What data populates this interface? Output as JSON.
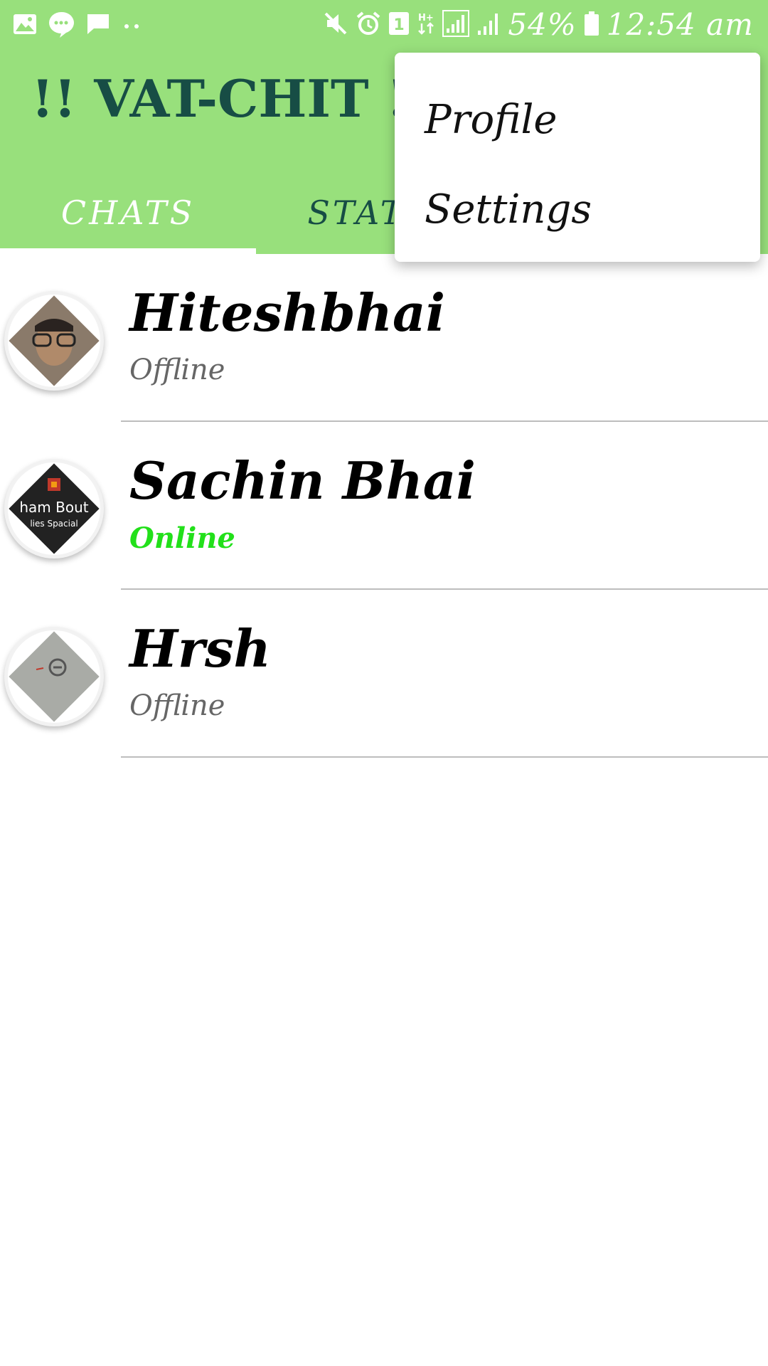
{
  "status_bar": {
    "battery": "54%",
    "time": "12:54 am",
    "icons_left": [
      "image-icon",
      "chat-bubble-icon",
      "message-icon",
      "more-dots-icon"
    ],
    "icons_right": [
      "mute-icon",
      "alarm-icon",
      "sim-icon",
      "data-icon",
      "signal-icon",
      "signal-icon",
      "battery-icon"
    ]
  },
  "app": {
    "title": "!! VAT-CHIT !!",
    "tabs": [
      {
        "label": "CHATS",
        "active": true
      },
      {
        "label": "STATUS",
        "active": false
      }
    ]
  },
  "chats": [
    {
      "name": "Hiteshbhai",
      "status": "Offline",
      "online": false
    },
    {
      "name": "Sachin Bhai",
      "status": "Online",
      "online": true
    },
    {
      "name": "Hrsh",
      "status": "Offline",
      "online": false
    }
  ],
  "menu": {
    "items": [
      "Profile",
      "Settings"
    ]
  },
  "colors": {
    "appbar": "#98e07c",
    "title": "#174d45",
    "online": "#22e01a",
    "offline": "#666666"
  }
}
